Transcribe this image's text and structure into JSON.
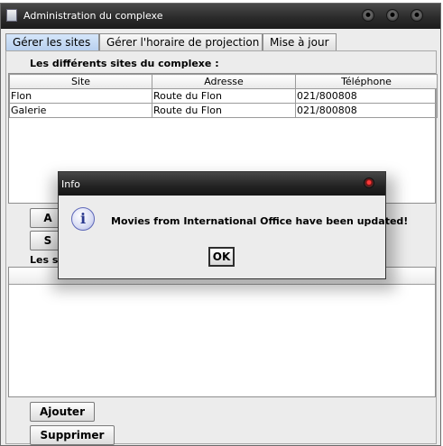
{
  "window": {
    "title": "Administration du complexe"
  },
  "tabs": [
    {
      "label": "Gérer les sites"
    },
    {
      "label": "Gérer l'horaire de projection"
    },
    {
      "label": "Mise à jour"
    }
  ],
  "sites_section": {
    "label": "Les différents sites du complexe :",
    "columns": [
      "Site",
      "Adresse",
      "Téléphone"
    ],
    "rows": [
      [
        "Flon",
        "Route du Flon",
        "021/800808"
      ],
      [
        "Galerie",
        "Route du Flon",
        "021/800808"
      ]
    ],
    "buttons": {
      "add_partial": "A",
      "delete_partial": "S"
    }
  },
  "second_section": {
    "label_partial": "Les s"
  },
  "bottom_buttons": {
    "add": "Ajouter",
    "delete": "Supprimer"
  },
  "dialog": {
    "title": "Info",
    "message": "Movies from International Office have been updated!",
    "ok_label": "OK",
    "icon_glyph": "i"
  }
}
